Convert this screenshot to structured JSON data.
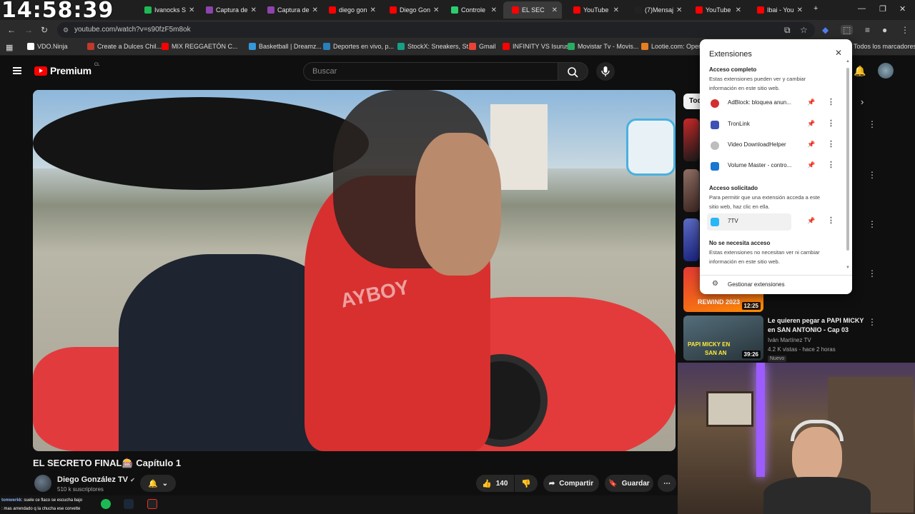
{
  "clock": "14:58:39",
  "tabs": [
    {
      "label": "Ivanocks S",
      "color": "#1db954"
    },
    {
      "label": "Captura de",
      "color": "#8e44ad"
    },
    {
      "label": "Captura de",
      "color": "#8e44ad"
    },
    {
      "label": "diego gon",
      "color": "#ff0000"
    },
    {
      "label": "Diego Gon",
      "color": "#ff0000"
    },
    {
      "label": "Controle",
      "color": "#2ecc71"
    },
    {
      "label": "EL SEC",
      "color": "#ff0000"
    },
    {
      "label": "YouTube",
      "color": "#ff0000"
    },
    {
      "label": "(7)Mensaj",
      "color": "#222222"
    },
    {
      "label": "YouTube",
      "color": "#ff0000"
    },
    {
      "label": "Ibai - You",
      "color": "#ff0000"
    }
  ],
  "address": {
    "url": "youtube.com/watch?v=s90fzF5m8ok"
  },
  "bookmarks": [
    {
      "label": "VDO.Ninja",
      "color": "#ffffff"
    },
    {
      "label": "Create a Dulces Chil...",
      "color": "#c0392b"
    },
    {
      "label": "MIX REGGAETÓN C...",
      "color": "#ff0000"
    },
    {
      "label": "Basketball | Dreamz...",
      "color": "#3498db"
    },
    {
      "label": "Deportes en vivo, p...",
      "color": "#2980b9"
    },
    {
      "label": "StockX: Sneakers, St...",
      "color": "#16a085"
    },
    {
      "label": "Gmail",
      "color": "#ea4335"
    },
    {
      "label": "INFINITY VS Isurus",
      "color": "#ff0000"
    },
    {
      "label": "Movistar Tv - Movis...",
      "color": "#27ae60"
    },
    {
      "label": "Lootie.com: Open...",
      "color": "#e67e22"
    }
  ],
  "all_bookmarks": "Todos los marcadores",
  "youtube": {
    "logo": "Premium",
    "country": "CL",
    "search_placeholder": "Buscar",
    "video_title": "EL SECRETO FINAL🎰 Capítulo 1",
    "channel_name": "Diego González TV",
    "subscribers": "510 k suscriptores",
    "likes": "140",
    "share": "Compartir",
    "save": "Guardar",
    "video_overlay_text": "AYBOY",
    "chip": "Tod"
  },
  "sidebar_video": {
    "title_line1": "Le quieren pegar a PAPI MICKY",
    "title_line2": "en SAN ANTONIO - Cap 03",
    "channel": "Iván Martínez TV",
    "meta": "4.2 K vistas - hace 2 horas",
    "badge": "Nuevo",
    "duration": "39:26",
    "thumb_text1": "PAPI MICKY EN",
    "thumb_text2": "SAN AN"
  },
  "sidebar_prev": {
    "duration": "12:25",
    "thumb_text": "REWIND 2023"
  },
  "extensions_popup": {
    "title": "Extensiones",
    "full_access_heading": "Acceso completo",
    "full_access_desc": "Estas extensiones pueden ver y cambiar información en este sitio web.",
    "full_access": [
      {
        "name": "AdBlock: bloquea anun...",
        "icon_color": "#d32f2f",
        "pinned": true
      },
      {
        "name": "TronLink",
        "icon_color": "#3f51b5",
        "pinned": true
      },
      {
        "name": "Video DownloadHelper",
        "icon_color": "#9e9e9e",
        "pinned": true
      },
      {
        "name": "Volume Master - contro...",
        "icon_color": "#1976d2",
        "pinned": true
      }
    ],
    "requested_heading": "Acceso solicitado",
    "requested_desc": "Para permitir que una extensión acceda a este sitio web, haz clic en ella.",
    "requested": [
      {
        "name": "7TV",
        "icon_color": "#29b6f6"
      }
    ],
    "no_access_heading": "No se necesita acceso",
    "no_access_desc": "Estas extensiones no necesitan ver ni cambiar información en este sitio web.",
    "manage": "Gestionar extensiones"
  },
  "chat": [
    {
      "user": "tomwerkk",
      "text": ": suele ce flaco se escucha bajo"
    },
    {
      "user": "",
      "text": ": mas arrendado q la chucha ese corvette"
    }
  ]
}
